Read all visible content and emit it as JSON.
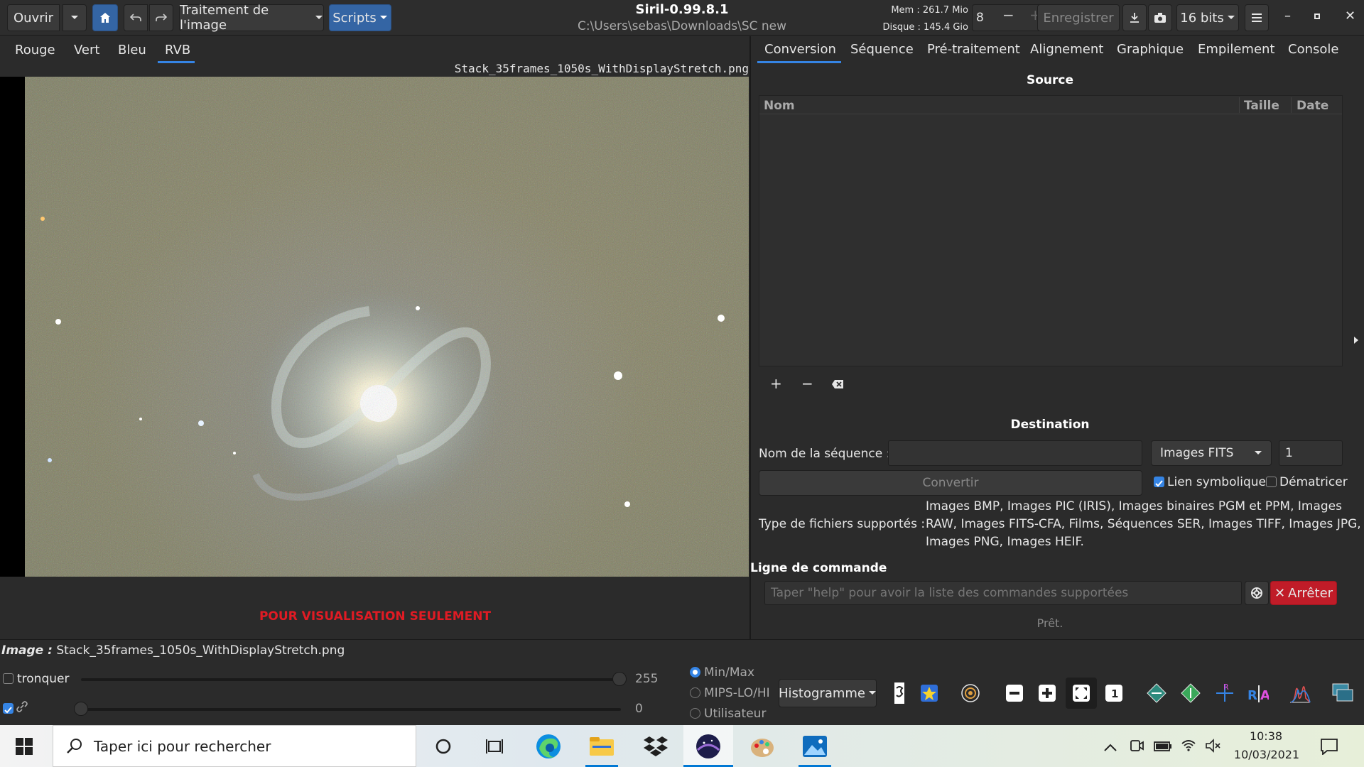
{
  "app": {
    "title": "Siril-0.99.8.1",
    "path": "C:\\Users\\sebas\\Downloads\\SC new",
    "mem": "Mem : 261.7 Mio",
    "disk": "Disque : 145.4 Gio",
    "thread_count": "8"
  },
  "header": {
    "open_label": "Ouvrir",
    "processing_label": "Traitement de l'image",
    "scripts_label": "Scripts",
    "save_label": "Enregistrer",
    "bitdepth_label": "16 bits"
  },
  "channel_tabs": [
    "Rouge",
    "Vert",
    "Bleu",
    "RVB"
  ],
  "image": {
    "filename": "Stack_35frames_1050s_WithDisplayStretch.png",
    "preview_warning": "POUR VISUALISATION SEULEMENT",
    "info_label": "Image :",
    "info_value": "Stack_35frames_1050s_WithDisplayStretch.png"
  },
  "right_tabs": [
    "Conversion",
    "Séquence",
    "Pré-traitement",
    "Alignement",
    "Graphique",
    "Empilement",
    "Console"
  ],
  "conversion": {
    "source_title": "Source",
    "columns": [
      "Nom",
      "Taille",
      "Date"
    ],
    "destination_title": "Destination",
    "sequence_name_label": "Nom de la séquence :",
    "sequence_name_value": "",
    "format_value": "Images FITS",
    "start_index": "1",
    "convert_label": "Convertir",
    "symlink_label": "Lien symbolique",
    "debayer_label": "Dématricer",
    "supported_label": "Type de fichiers supportés :",
    "supported_line1": "Images BMP, Images PIC (IRIS), Images binaires PGM et PPM, Images",
    "supported_line2": "RAW, Images FITS-CFA, Films, Séquences SER, Images TIFF, Images JPG,",
    "supported_line3": "Images PNG, Images HEIF."
  },
  "command": {
    "title": "Ligne de commande",
    "placeholder": "Taper \"help\" pour avoir la liste des commandes supportées",
    "stop_label": "Arrêter",
    "status": "Prêt."
  },
  "display": {
    "clip_label": "tronquer",
    "max_value": "255",
    "min_value": "0",
    "range_options": [
      "Min/Max",
      "MIPS-LO/HI",
      "Utilisateur"
    ],
    "mode_label": "Histogramme"
  },
  "taskbar": {
    "search_placeholder": "Taper ici pour rechercher",
    "time": "10:38",
    "date": "10/03/2021"
  }
}
